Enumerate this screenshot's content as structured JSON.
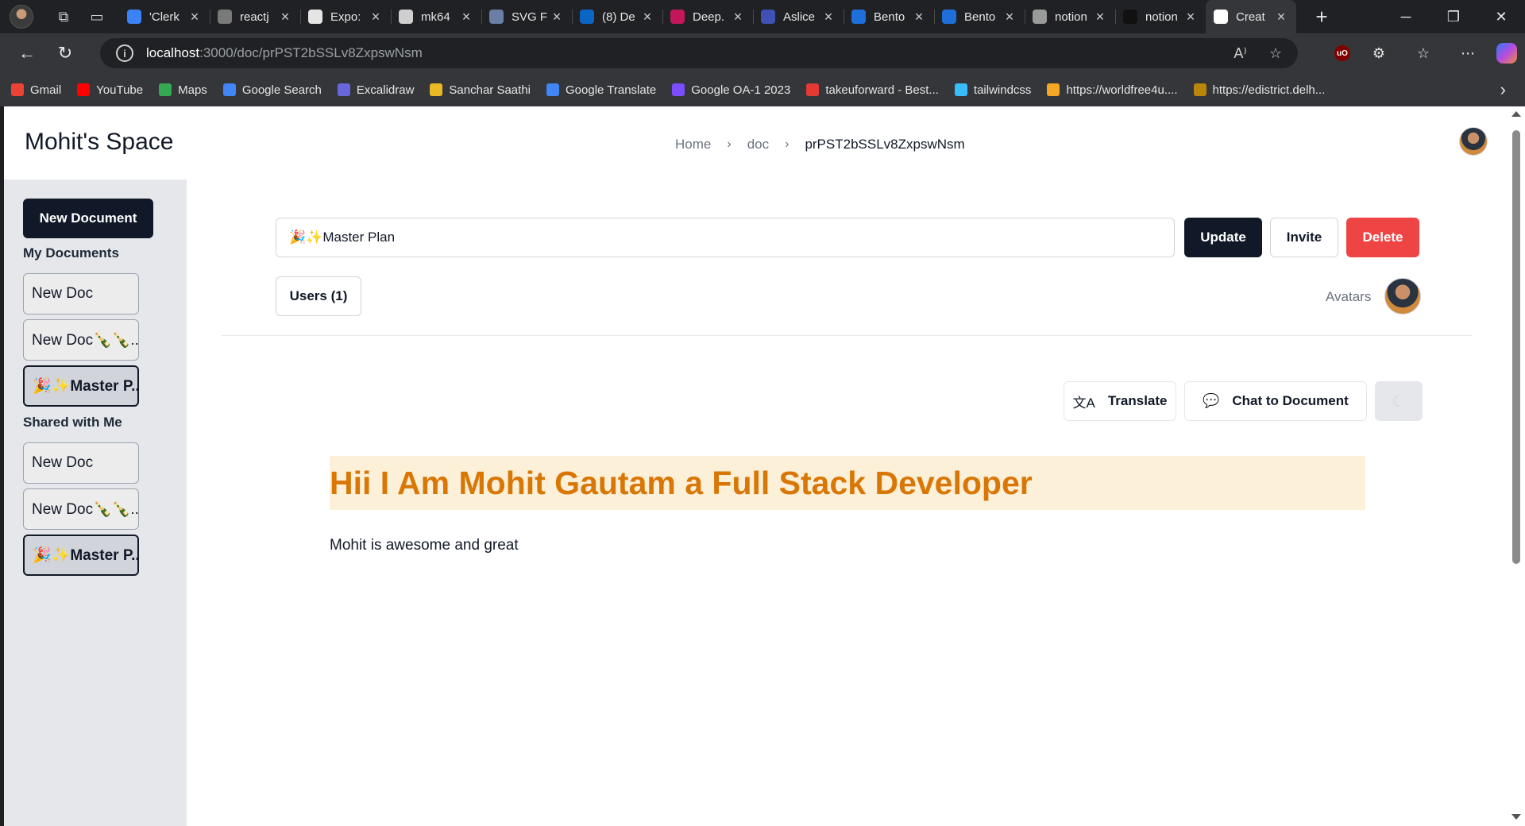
{
  "browser": {
    "tabs": [
      {
        "title": "'Clerk",
        "favicon_color": "#3b82f6"
      },
      {
        "title": "reactj",
        "favicon_color": "#7a7a7a"
      },
      {
        "title": "Expo:",
        "favicon_color": "#e5e5e5"
      },
      {
        "title": "mk64",
        "favicon_color": "#cfcfcf"
      },
      {
        "title": "SVG F",
        "favicon_color": "#6b7ea6"
      },
      {
        "title": "(8) De",
        "favicon_color": "#0a66c2"
      },
      {
        "title": "Deep.",
        "favicon_color": "#c2185b"
      },
      {
        "title": "Aslice",
        "favicon_color": "#3f51b5"
      },
      {
        "title": "Bento",
        "favicon_color": "#1e6fd9"
      },
      {
        "title": "Bento",
        "favicon_color": "#1e6fd9"
      },
      {
        "title": "notion",
        "favicon_color": "#9a9a9a"
      },
      {
        "title": "notion",
        "favicon_color": "#111111"
      },
      {
        "title": "Creat",
        "favicon_color": "#ffffff"
      }
    ],
    "url_host": "localhost",
    "url_path": ":3000/doc/prPST2bSSLv8ZxpswNsm",
    "bookmarks": [
      {
        "label": "Gmail",
        "color": "#ea4335"
      },
      {
        "label": "YouTube",
        "color": "#ff0000"
      },
      {
        "label": "Maps",
        "color": "#34a853"
      },
      {
        "label": "Google Search",
        "color": "#4285f4"
      },
      {
        "label": "Excalidraw",
        "color": "#6965db"
      },
      {
        "label": "Sanchar Saathi",
        "color": "#e8b923"
      },
      {
        "label": "Google Translate",
        "color": "#4285f4"
      },
      {
        "label": "Google OA-1 2023",
        "color": "#7c4dff"
      },
      {
        "label": "takeuforward - Best...",
        "color": "#e53935"
      },
      {
        "label": "tailwindcss",
        "color": "#38bdf8"
      },
      {
        "label": "https://worldfree4u....",
        "color": "#f5a623"
      },
      {
        "label": "https://edistrict.delh...",
        "color": "#b8860b"
      }
    ]
  },
  "app": {
    "brand": "Mohit's Space",
    "breadcrumb": {
      "home": "Home",
      "doc": "doc",
      "current": "prPST2bSSLv8ZxpswNsm"
    }
  },
  "sidebar": {
    "new_doc_label": "New Document",
    "my_docs_heading": "My Documents",
    "my_docs": [
      "New Doc",
      "New Doc🍾🍾...",
      "🎉✨Master P..."
    ],
    "shared_heading": "Shared with Me",
    "shared_docs": [
      "New Doc",
      "New Doc🍾🍾...",
      "🎉✨Master P..."
    ]
  },
  "editor": {
    "title_value": "🎉✨Master Plan",
    "update_label": "Update",
    "invite_label": "Invite",
    "delete_label": "Delete",
    "users_label": "Users (1)",
    "avatars_label": "Avatars",
    "translate_label": "Translate",
    "chat_label": "Chat to Document",
    "heading": "Hii I Am Mohit Gautam a Full Stack Developer",
    "paragraph": "Mohit is awesome and great"
  },
  "colors": {
    "primary": "#111827",
    "danger": "#ef4444",
    "heading_text": "#d97706",
    "heading_bg": "#fdf0d8",
    "sidebar_bg": "#e5e7eb"
  }
}
